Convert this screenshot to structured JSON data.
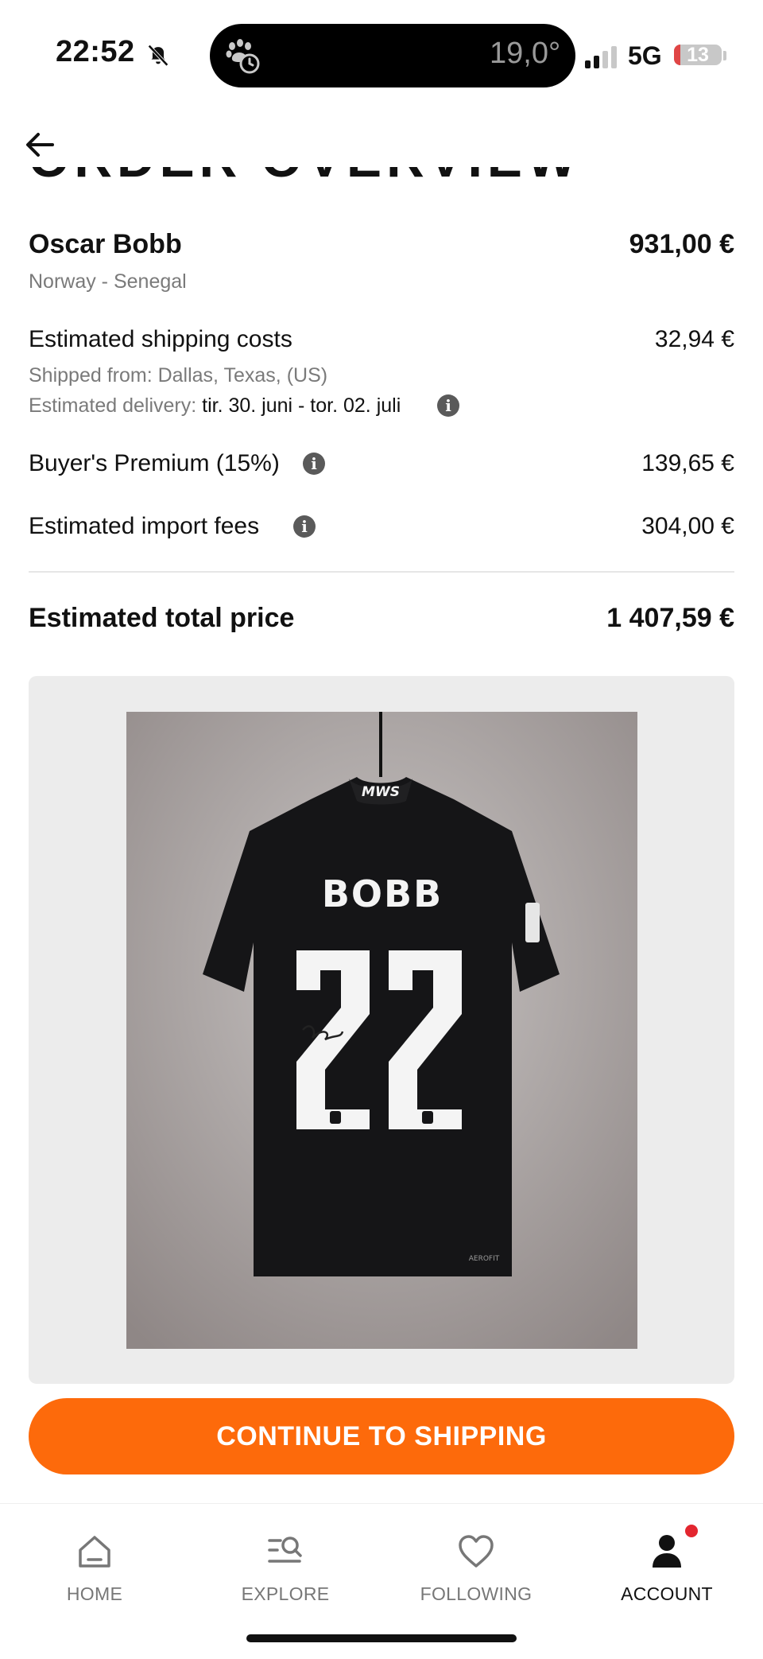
{
  "status_bar": {
    "time": "22:52",
    "temperature": "19,0°",
    "network": "5G",
    "battery": "13",
    "battery_fraction": 0.13,
    "icons": [
      "bell-muted-icon",
      "paw-timer-icon",
      "signal-bars-icon",
      "battery-icon"
    ]
  },
  "header": {
    "back_icon": "arrow-left-icon",
    "heading": "ORDER OVERVIEW"
  },
  "order": {
    "item_name": "Oscar Bobb",
    "item_price": "931,00 €",
    "item_subtitle": "Norway - Senegal",
    "shipping_label": "Estimated shipping costs",
    "shipping_price": "32,94 €",
    "shipped_from": "Shipped from: Dallas, Texas, (US)",
    "delivery_label": "Estimated delivery: ",
    "delivery_dates": "tir. 30. juni - tor. 02. juli",
    "premium_label": "Buyer's Premium (15%)",
    "premium_price": "139,65 €",
    "import_label": "Estimated import fees",
    "import_price": "304,00 €",
    "total_label": "Estimated total price",
    "total_price": "1 407,59 €"
  },
  "product_image": {
    "hanger_text": "MWS",
    "shirt_name": "BOBB",
    "shirt_number": "22",
    "tag_text": "AEROFIT",
    "colors": {
      "shirt": "#151517",
      "print": "#f4f4f4",
      "backdrop": "#a9a3a2"
    }
  },
  "cta": {
    "label": "CONTINUE TO SHIPPING",
    "color": "#fd6a0b"
  },
  "nav": {
    "items": [
      {
        "label": "HOME",
        "icon": "home-icon"
      },
      {
        "label": "EXPLORE",
        "icon": "explore-icon"
      },
      {
        "label": "FOLLOWING",
        "icon": "heart-icon"
      },
      {
        "label": "ACCOUNT",
        "icon": "account-icon"
      }
    ],
    "active": "ACCOUNT"
  }
}
